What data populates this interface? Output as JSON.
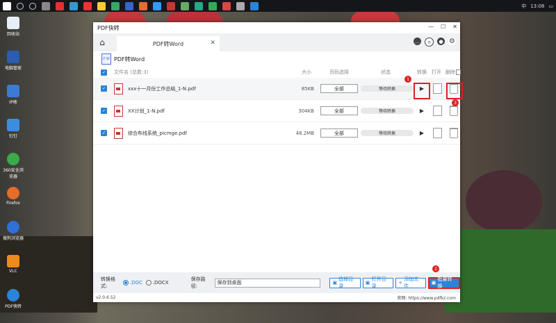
{
  "window": {
    "title": "PDF快转",
    "tab_label": "PDF转Word",
    "section_title": "PDF转Word"
  },
  "desktop": [
    {
      "label": "回收站",
      "color": "#e8eef5"
    },
    {
      "label": "电脑管家",
      "color": "#2a5db0"
    },
    {
      "label": "IP地",
      "color": "#3b7ad6"
    },
    {
      "label": "钉钉",
      "color": "#3c8de0"
    },
    {
      "label": "360安全浏览器",
      "color": "#3aaa4a"
    },
    {
      "label": "Firefox",
      "color": "#e66b2c"
    },
    {
      "label": "搜狗浏览器",
      "color": "#2f6fd8"
    },
    {
      "label": "VLC",
      "color": "#f08a1c"
    },
    {
      "label": "PDF快转",
      "color": "#2b84d6"
    }
  ],
  "taskbar": {
    "time": "13:08",
    "lang": "中"
  },
  "table": {
    "headers": {
      "filename": "文件名 (总数:3)",
      "size": "大小",
      "pages": "页码选择",
      "status": "状态",
      "convert": "转换",
      "open": "打开",
      "delete": "删除"
    },
    "rows": [
      {
        "name": "xxx十一月份工作总结_1-N.pdf",
        "size": "85KB",
        "pages": "全部",
        "status": "等待转换"
      },
      {
        "name": "XX计划_1-N.pdf",
        "size": "304KB",
        "pages": "全部",
        "status": "等待转换"
      },
      {
        "name": "综合布线系统_picmge.pdf",
        "size": "48.2MB",
        "pages": "全部",
        "status": "等待转换"
      }
    ]
  },
  "bottom": {
    "format_label": "转换格式:",
    "opt_doc": ".DOC",
    "opt_docx": ".DOCX",
    "save_label": "保存路径:",
    "save_path": "保存到桌面",
    "btn_choose": "选择目录",
    "btn_open": "打开目录",
    "btn_add": "添加文件",
    "btn_batch": "批量转换"
  },
  "footer": {
    "version": "v2.0.6.52",
    "website": "官网: https://www.pdfkz.com"
  },
  "badges": [
    "1",
    "2",
    "3"
  ],
  "colors": {
    "accent": "#2b84d6",
    "highlight": "#e02020"
  }
}
